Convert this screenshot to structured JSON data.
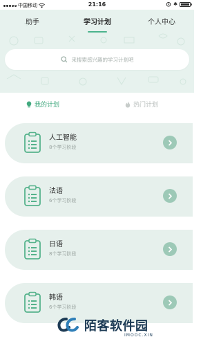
{
  "status_bar": {
    "carrier": "中国移动",
    "time": "21:16",
    "bluetooth": "✱"
  },
  "tabs": [
    {
      "label": "助手",
      "active": false
    },
    {
      "label": "学习计划",
      "active": true
    },
    {
      "label": "个人中心",
      "active": false
    }
  ],
  "search": {
    "placeholder": "来搜索感兴趣的学习计划吧",
    "icon": "search-icon"
  },
  "segments": [
    {
      "label": "我的计划",
      "active": true,
      "icon": "lightbulb-icon"
    },
    {
      "label": "热门计划",
      "active": false,
      "icon": "flame-icon"
    }
  ],
  "plans": [
    {
      "title": "人工智能",
      "subtitle": "8个学习阶段",
      "icon": "clipboard-icon"
    },
    {
      "title": "法语",
      "subtitle": "6个学习阶段",
      "icon": "clipboard-icon"
    },
    {
      "title": "日语",
      "subtitle": "8个学习阶段",
      "icon": "clipboard-icon"
    },
    {
      "title": "韩语",
      "subtitle": "6个学习阶段",
      "icon": "clipboard-icon"
    }
  ],
  "watermark": {
    "text": "陌客软件园",
    "sub": "IMOOC.XIN"
  },
  "colors": {
    "accent": "#4bb38c",
    "header_bg": "#e7f2ee",
    "card_bg": "#e6f0ec",
    "arrow_bg": "#9dc9b7"
  }
}
